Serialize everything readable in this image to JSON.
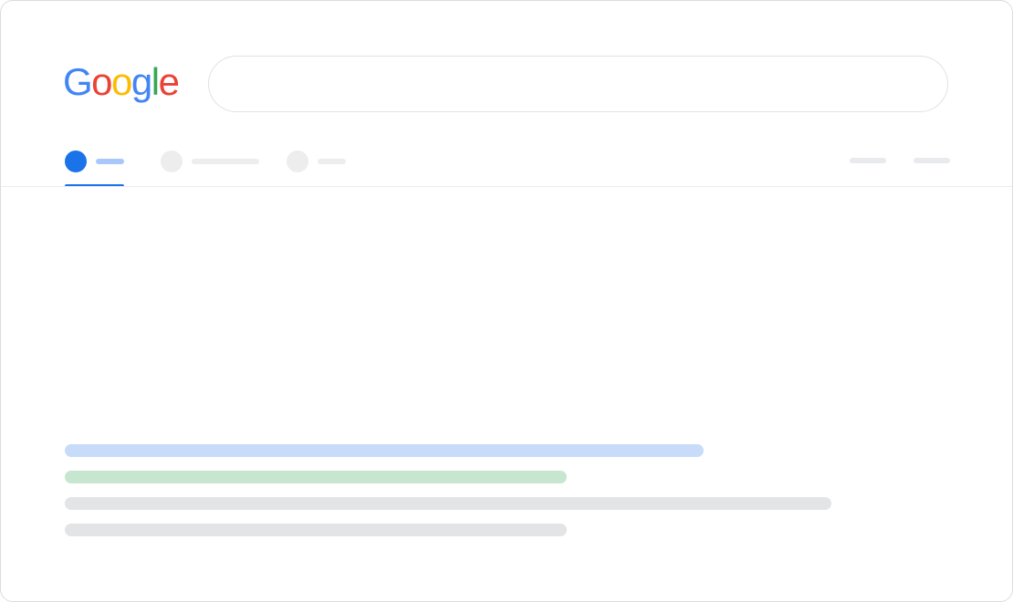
{
  "logo": {
    "letters": [
      "G",
      "o",
      "o",
      "g",
      "l",
      "e"
    ],
    "colors": [
      "#4285f4",
      "#ea4335",
      "#fbbc05",
      "#4285f4",
      "#34a853",
      "#ea4335"
    ]
  },
  "search": {
    "value": "",
    "placeholder": ""
  },
  "tabs": [
    {
      "active": true,
      "dot_color": "#1a73e8",
      "bar_color": "#a8c7fa"
    },
    {
      "active": false,
      "dot_color": "#e8eaed",
      "bar_color": "#e8eaed"
    },
    {
      "active": false,
      "dot_color": "#e8eaed",
      "bar_color": "#e8eaed"
    }
  ],
  "colors": {
    "accent": "#1a73e8",
    "result_title": "#c8dcfa",
    "result_url": "#c6e6cf",
    "result_snippet": "#e3e4e6",
    "border": "#dadce0"
  }
}
